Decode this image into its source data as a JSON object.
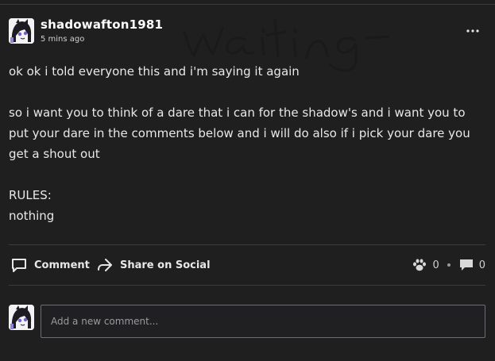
{
  "post": {
    "author": "shadowafton1981",
    "time": "5 mins ago",
    "image_text": "waiting",
    "body": {
      "line1": "ok ok i told everyone this and i'm saying it again",
      "paragraph2": "so i want you to think of a dare that i can for the shadow's and i want you to put your dare in the comments below and i will do also if i pick your dare you get a shout out",
      "rules_heading": "RULES:",
      "rules_value": "nothing"
    }
  },
  "actions": {
    "comment_label": "Comment",
    "share_label": "Share on Social"
  },
  "stats": {
    "likes": "0",
    "comments": "0"
  },
  "comment_box": {
    "placeholder": "Add a new comment..."
  },
  "icons": {
    "more": "more-options-icon",
    "comment": "comment-icon",
    "share": "share-icon",
    "like": "paw-like-icon",
    "comments_count": "speech-bubble-icon"
  }
}
